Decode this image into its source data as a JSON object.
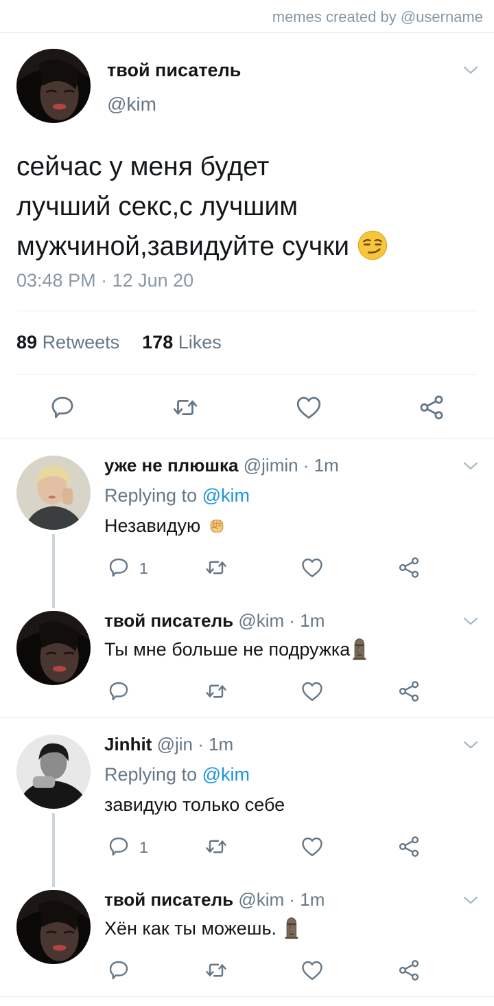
{
  "watermark": "memes created by @username",
  "main_tweet": {
    "name": "твой писатель",
    "handle": "@kim",
    "text_lines": [
      "сейчас у меня будет",
      "лучший секс,с лучшим",
      "мужчиной,завидуйте сучки"
    ],
    "emoji": "smirking-face",
    "timestamp": "03:48 PM · 12 Jun 20",
    "retweets": "89",
    "retweets_label": "Retweets",
    "likes": "178",
    "likes_label": "Likes"
  },
  "replies": [
    {
      "name": "уже не плюшка",
      "meta": "@jimin · 1m",
      "replying_prefix": "Replying to",
      "replying_mention": "@kim",
      "text": "Незавидую",
      "emoji": "raised-fist",
      "reply_count": "1"
    },
    {
      "name": "твой писатель",
      "meta": "@kim · 1m",
      "text": "Ты мне больше не подружка",
      "emoji": "moai"
    },
    {
      "name": "Jinhit",
      "meta": "@jin · 1m",
      "replying_prefix": "Replying to",
      "replying_mention": "@kim",
      "text": "завидую только себе",
      "reply_count": "1"
    },
    {
      "name": "твой писатель",
      "meta": "@kim · 1m",
      "text": "Хён как ты можешь.",
      "emoji": "moai"
    }
  ],
  "colors": {
    "text": "#14171a",
    "secondary": "#657786",
    "mention": "#1b95e0",
    "divider": "#e6ecf0",
    "thread_line": "#ccd6dd"
  }
}
